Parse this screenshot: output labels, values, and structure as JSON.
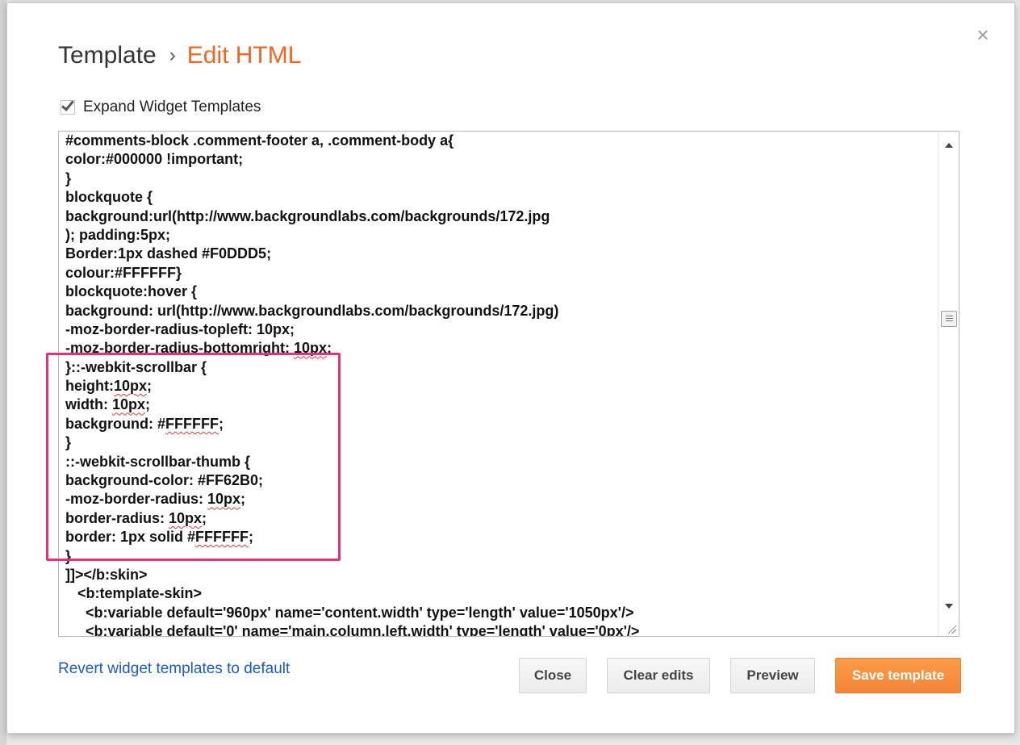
{
  "dialog": {
    "breadcrumb_parent": "Template",
    "breadcrumb_separator": "›",
    "breadcrumb_current": "Edit HTML",
    "close_glyph": "×",
    "expand_checkbox": {
      "label": "Expand Widget Templates",
      "checked": true
    },
    "revert_link": "Revert widget templates to default"
  },
  "editor": {
    "lines": [
      "#comments-block .comment-footer a, .comment-body a{",
      "color:#000000 !important;",
      "}",
      "blockquote {",
      "background:url(http://www.backgroundlabs.com/backgrounds/172.jpg",
      "); padding:5px;",
      "Border:1px dashed #F0DDD5;",
      "colour:#FFFFFF}",
      "blockquote:hover {",
      "background: url(http://www.backgroundlabs.com/backgrounds/172.jpg)",
      "-moz-border-radius-topleft: 10px;",
      "-moz-border-radius-bottomright: 10px;",
      "}::-webkit-scrollbar {",
      "height:10px;",
      "width: 10px;",
      "background: #FFFFFF;",
      "}",
      "::-webkit-scrollbar-thumb {",
      "background-color: #FF62B0;",
      "-moz-border-radius: 10px;",
      "border-radius: 10px;",
      "border: 1px solid #FFFFFF;",
      "}",
      "]]></b:skin>",
      "   <b:template-skin>",
      "     <b:variable default='960px' name='content.width' type='length' value='1050px'/>",
      "     <b:variable default='0' name='main.column.left.width' type='length' value='0px'/>"
    ]
  },
  "buttons": {
    "close": "Close",
    "clear_edits": "Clear edits",
    "preview": "Preview",
    "save_template": "Save template"
  },
  "colors": {
    "accent_orange": "#f26522",
    "save_button": "#f5853a",
    "highlight_box": "#e8307a",
    "link_blue": "#1a5bc6"
  }
}
